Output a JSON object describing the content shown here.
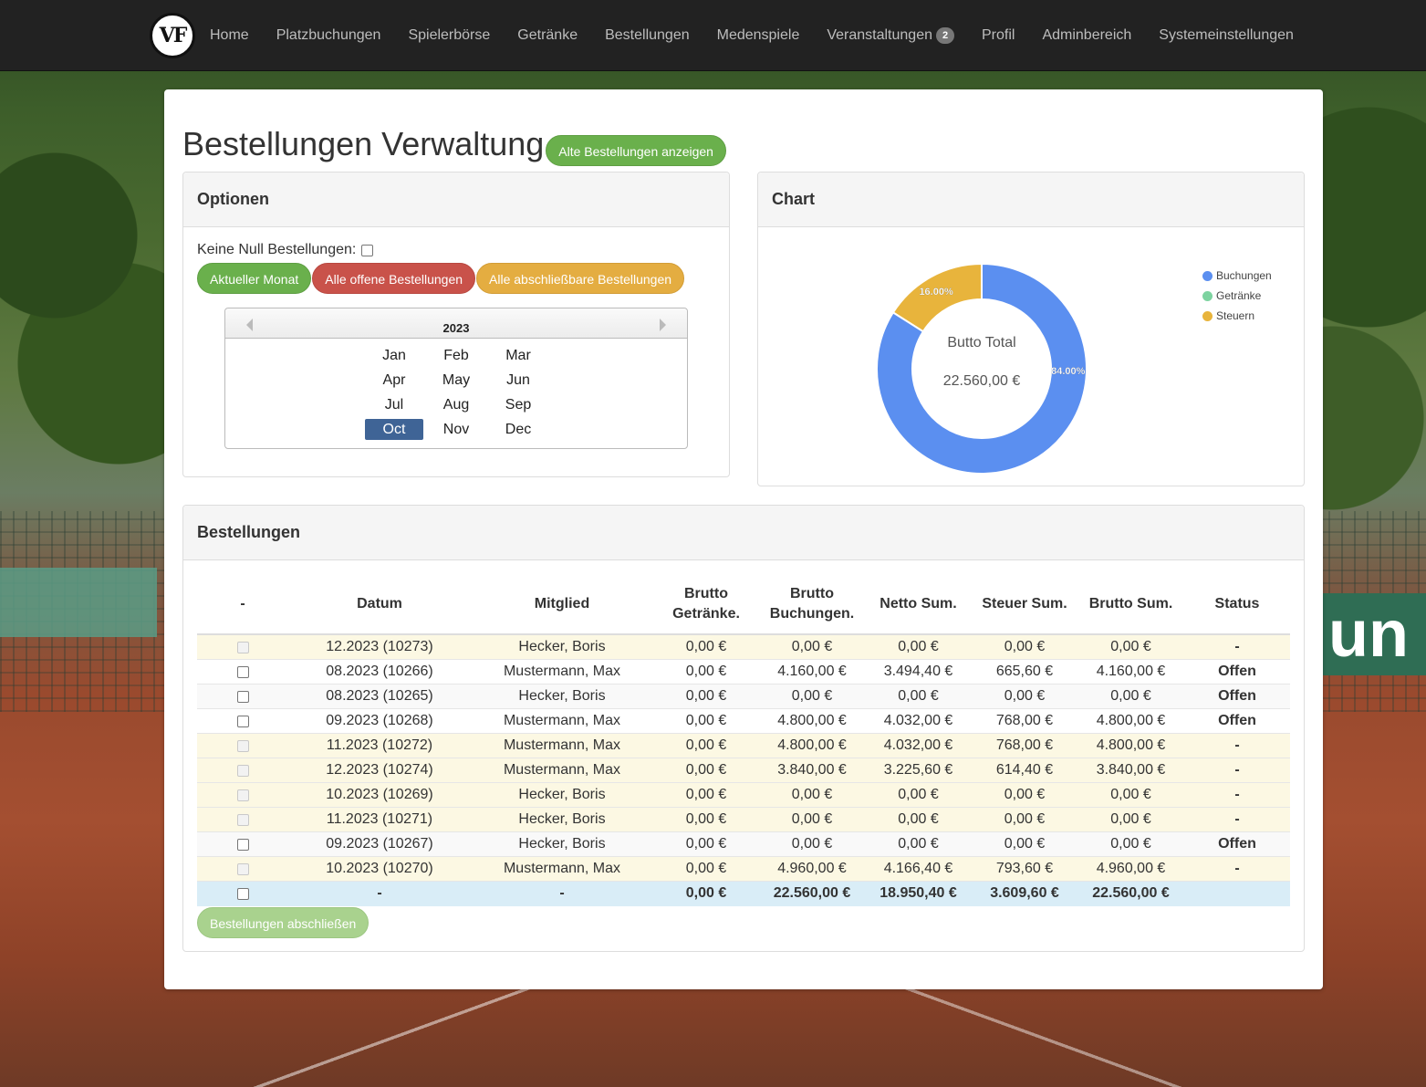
{
  "nav": {
    "logo_text": "VF",
    "items": [
      {
        "label": "Home"
      },
      {
        "label": "Platzbuchungen"
      },
      {
        "label": "Spielerbörse"
      },
      {
        "label": "Getränke"
      },
      {
        "label": "Bestellungen"
      },
      {
        "label": "Medenspiele"
      },
      {
        "label": "Veranstaltungen",
        "badge": "2"
      },
      {
        "label": "Profil"
      },
      {
        "label": "Adminbereich"
      },
      {
        "label": "Systemeinstellungen"
      }
    ]
  },
  "page": {
    "title": "Bestellungen Verwaltung",
    "show_old_button": "Alte Bestellungen anzeigen"
  },
  "options": {
    "heading": "Optionen",
    "no_null_label": "Keine Null Bestellungen:",
    "btn_current_month": "Aktueller Monat",
    "btn_open_orders": "Alle offene Bestellungen",
    "btn_closable_orders": "Alle abschließbare Bestellungen",
    "calendar": {
      "year": "2023",
      "months": [
        "Jan",
        "Feb",
        "Mar",
        "Apr",
        "May",
        "Jun",
        "Jul",
        "Aug",
        "Sep",
        "Oct",
        "Nov",
        "Dec"
      ],
      "selected": "Oct"
    }
  },
  "chart": {
    "heading": "Chart",
    "center_label": "Butto Total",
    "center_value": "22.560,00 €",
    "colors": {
      "buchungen": "#5b8ff0",
      "getraenke": "#7dd3a0",
      "steuern": "#e8b43c"
    }
  },
  "chart_data": {
    "type": "pie",
    "categories": [
      "Buchungen",
      "Getränke",
      "Steuern"
    ],
    "values": [
      84.0,
      0.0,
      16.0
    ],
    "value_labels": [
      "84.00%",
      "",
      "16.00%"
    ],
    "legend": "top-right"
  },
  "orders": {
    "heading": "Bestellungen",
    "columns": [
      "-",
      "Datum",
      "Mitglied",
      "Brutto Getränke.",
      "Brutto Buchungen.",
      "Netto Sum.",
      "Steuer Sum.",
      "Brutto Sum.",
      "Status"
    ],
    "rows": [
      {
        "datum": "12.2023 (10273)",
        "mitglied": "Hecker, Boris",
        "getraenke": "0,00 €",
        "buchungen": "0,00 €",
        "netto": "0,00 €",
        "steuer": "0,00 €",
        "brutto": "0,00 €",
        "status": "-",
        "style": "warning",
        "checkbox_disabled": true
      },
      {
        "datum": "08.2023 (10266)",
        "mitglied": "Mustermann, Max",
        "getraenke": "0,00 €",
        "buchungen": "4.160,00 €",
        "netto": "3.494,40 €",
        "steuer": "665,60 €",
        "brutto": "4.160,00 €",
        "status": "Offen",
        "style": "white",
        "checkbox_disabled": false
      },
      {
        "datum": "08.2023 (10265)",
        "mitglied": "Hecker, Boris",
        "getraenke": "0,00 €",
        "buchungen": "0,00 €",
        "netto": "0,00 €",
        "steuer": "0,00 €",
        "brutto": "0,00 €",
        "status": "Offen",
        "style": "gray",
        "checkbox_disabled": false
      },
      {
        "datum": "09.2023 (10268)",
        "mitglied": "Mustermann, Max",
        "getraenke": "0,00 €",
        "buchungen": "4.800,00 €",
        "netto": "4.032,00 €",
        "steuer": "768,00 €",
        "brutto": "4.800,00 €",
        "status": "Offen",
        "style": "white",
        "checkbox_disabled": false
      },
      {
        "datum": "11.2023 (10272)",
        "mitglied": "Mustermann, Max",
        "getraenke": "0,00 €",
        "buchungen": "4.800,00 €",
        "netto": "4.032,00 €",
        "steuer": "768,00 €",
        "brutto": "4.800,00 €",
        "status": "-",
        "style": "warning",
        "checkbox_disabled": true
      },
      {
        "datum": "12.2023 (10274)",
        "mitglied": "Mustermann, Max",
        "getraenke": "0,00 €",
        "buchungen": "3.840,00 €",
        "netto": "3.225,60 €",
        "steuer": "614,40 €",
        "brutto": "3.840,00 €",
        "status": "-",
        "style": "warning",
        "checkbox_disabled": true
      },
      {
        "datum": "10.2023 (10269)",
        "mitglied": "Hecker, Boris",
        "getraenke": "0,00 €",
        "buchungen": "0,00 €",
        "netto": "0,00 €",
        "steuer": "0,00 €",
        "brutto": "0,00 €",
        "status": "-",
        "style": "warning",
        "checkbox_disabled": true
      },
      {
        "datum": "11.2023 (10271)",
        "mitglied": "Hecker, Boris",
        "getraenke": "0,00 €",
        "buchungen": "0,00 €",
        "netto": "0,00 €",
        "steuer": "0,00 €",
        "brutto": "0,00 €",
        "status": "-",
        "style": "warning",
        "checkbox_disabled": true
      },
      {
        "datum": "09.2023 (10267)",
        "mitglied": "Hecker, Boris",
        "getraenke": "0,00 €",
        "buchungen": "0,00 €",
        "netto": "0,00 €",
        "steuer": "0,00 €",
        "brutto": "0,00 €",
        "status": "Offen",
        "style": "gray",
        "checkbox_disabled": false
      },
      {
        "datum": "10.2023 (10270)",
        "mitglied": "Mustermann, Max",
        "getraenke": "0,00 €",
        "buchungen": "4.960,00 €",
        "netto": "4.166,40 €",
        "steuer": "793,60 €",
        "brutto": "4.960,00 €",
        "status": "-",
        "style": "warning",
        "checkbox_disabled": true
      }
    ],
    "total": {
      "datum": "-",
      "mitglied": "-",
      "getraenke": "0,00 €",
      "buchungen": "22.560,00 €",
      "netto": "18.950,40 €",
      "steuer": "3.609,60 €",
      "brutto": "22.560,00 €",
      "status": ""
    },
    "close_button": "Bestellungen abschließen"
  },
  "background": {
    "banner_text": "un"
  }
}
